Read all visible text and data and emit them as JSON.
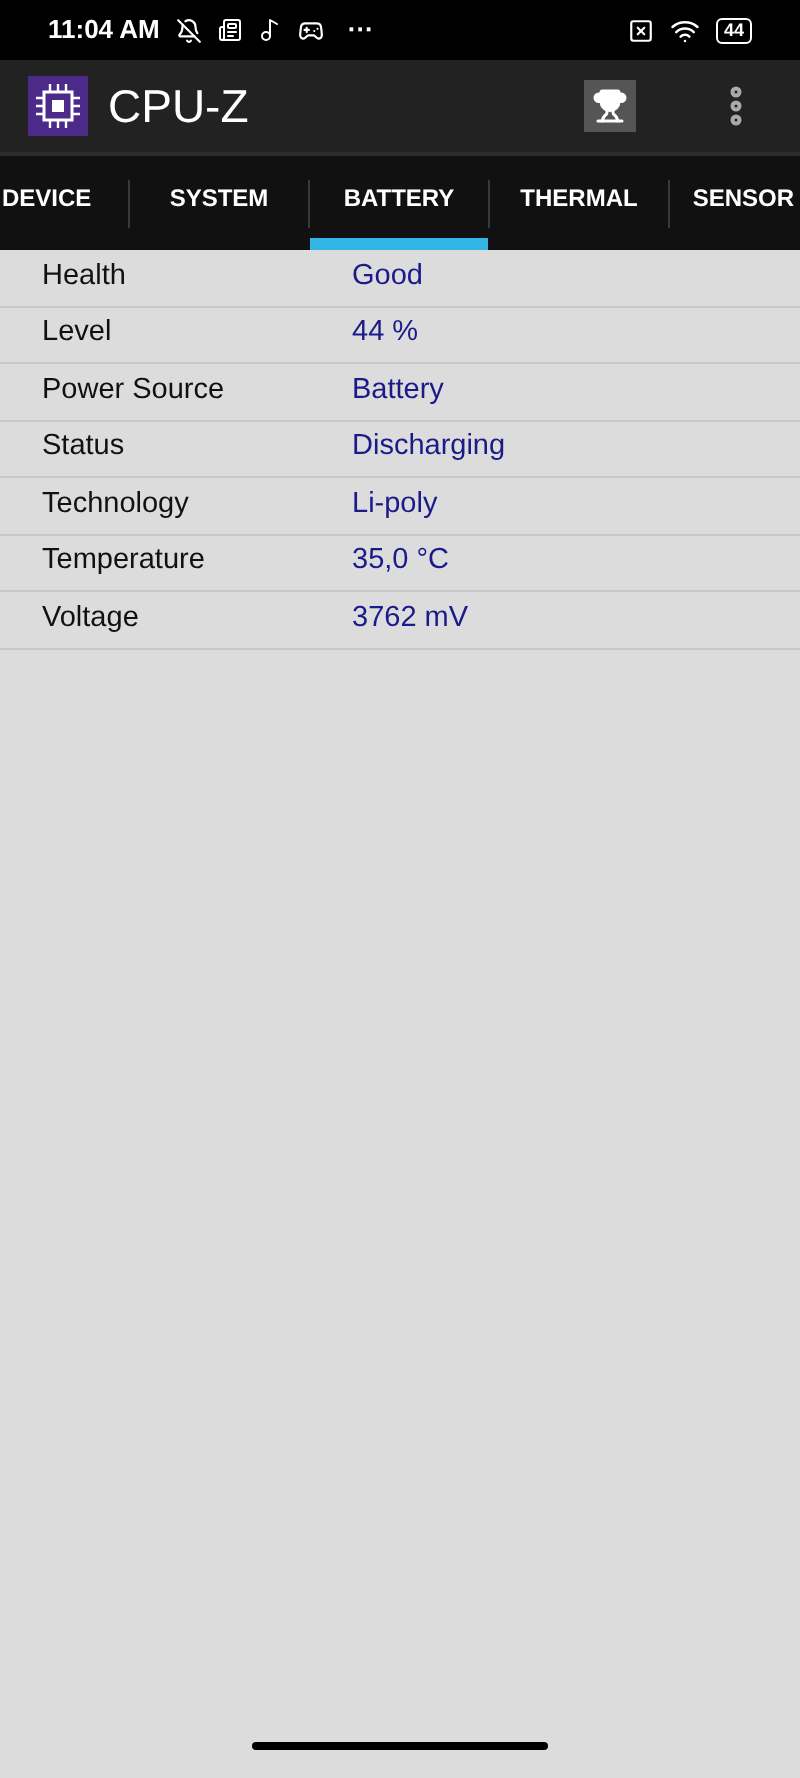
{
  "status_bar": {
    "time": "11:04 AM",
    "more": "···",
    "battery": "44"
  },
  "app_bar": {
    "title": "CPU-Z"
  },
  "tabs": [
    {
      "label": "DEVICE",
      "selected": false
    },
    {
      "label": "SYSTEM",
      "selected": false
    },
    {
      "label": "BATTERY",
      "selected": true
    },
    {
      "label": "THERMAL",
      "selected": false
    },
    {
      "label": "SENSOR",
      "selected": false
    }
  ],
  "rows": [
    {
      "label": "Health",
      "value": "Good"
    },
    {
      "label": "Level",
      "value": "44 %"
    },
    {
      "label": "Power Source",
      "value": "Battery"
    },
    {
      "label": "Status",
      "value": "Discharging"
    },
    {
      "label": "Technology",
      "value": "Li-poly"
    },
    {
      "label": "Temperature",
      "value": "35,0 °C"
    },
    {
      "label": "Voltage",
      "value": "3762 mV"
    }
  ]
}
